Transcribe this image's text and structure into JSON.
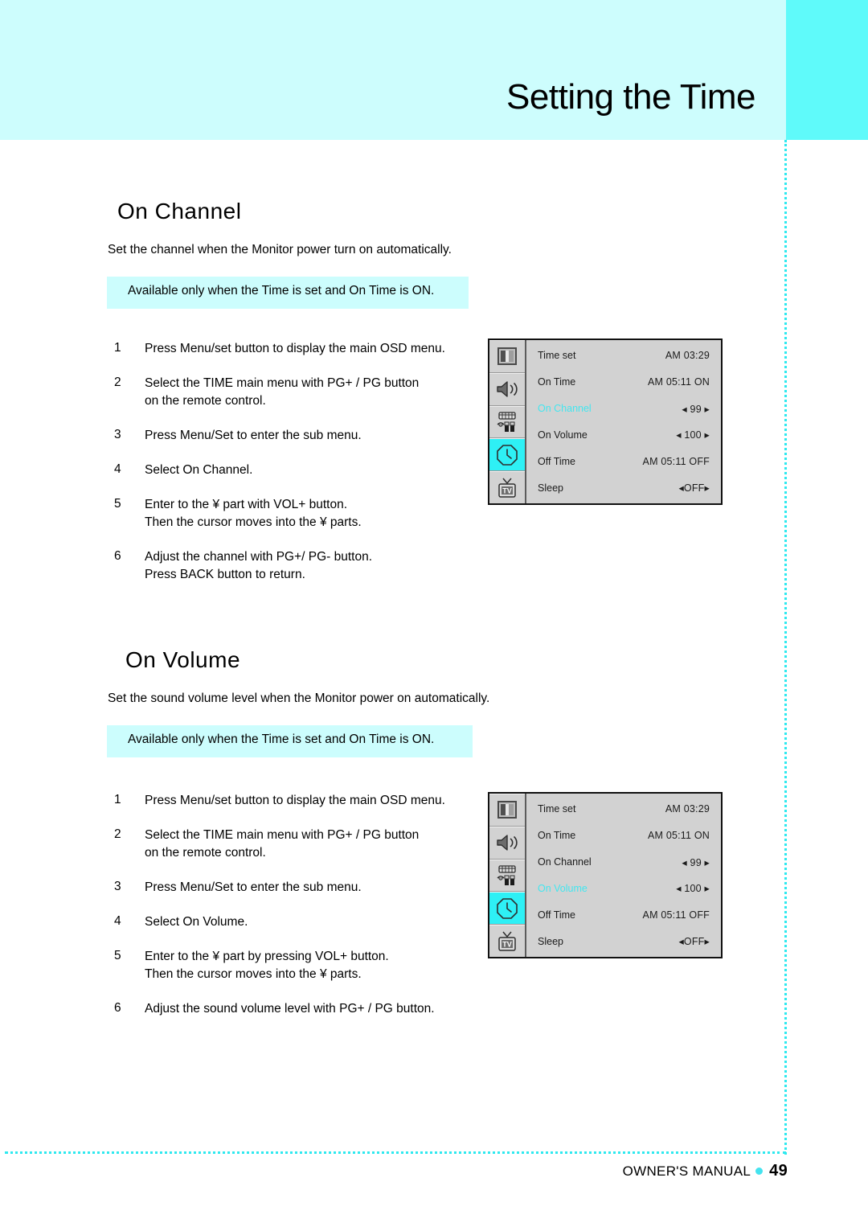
{
  "page": {
    "title": "Setting the Time",
    "footer_label": "OWNER'S MANUAL",
    "page_number": "49",
    "accent_cyan": "#5ffafa",
    "band_cyan": "#cdfdfd",
    "note_cyan": "#ccfdfd",
    "osd_highlight_cyan": "#2ef0f5"
  },
  "sections": [
    {
      "heading": "On Channel",
      "description": "Set the channel when the Monitor power turn on automatically.",
      "note": "Available only when the Time is set and On Time is ON.",
      "steps": [
        {
          "num": "1",
          "text": "Press Menu/set button to display the main OSD menu."
        },
        {
          "num": "2",
          "text": "Select the TIME main menu with PG+ / PG button\non the remote control."
        },
        {
          "num": "3",
          "text": "Press Menu/Set to enter the sub menu."
        },
        {
          "num": "4",
          "text": "Select On Channel."
        },
        {
          "num": "5",
          "text": "Enter to the  ¥     part with VOL+ button.\nThen the cursor moves into the  ¥     parts."
        },
        {
          "num": "6",
          "text": "Adjust the channel with PG+/ PG- button.\nPress BACK button to return."
        }
      ],
      "osd": {
        "icons": [
          {
            "name": "picture-icon",
            "active": false
          },
          {
            "name": "sound-icon",
            "active": false
          },
          {
            "name": "special-icon",
            "active": false
          },
          {
            "name": "clock-icon",
            "active": true
          },
          {
            "name": "tv-icon",
            "active": false
          }
        ],
        "rows": [
          {
            "label": "Time set",
            "value": "AM 03:29",
            "highlight": false
          },
          {
            "label": "On Time",
            "value": "AM 05:11 ON",
            "highlight": false
          },
          {
            "label": "On Channel",
            "value": "◂  99  ▸",
            "highlight": true
          },
          {
            "label": "On Volume",
            "value": "◂ 100 ▸",
            "highlight": false
          },
          {
            "label": "Off Time",
            "value": "AM 05:11 OFF",
            "highlight": false
          },
          {
            "label": "Sleep",
            "value": "◂OFF▸",
            "highlight": false
          }
        ]
      }
    },
    {
      "heading": "On Volume",
      "description": "Set the sound volume level when the Monitor power on automatically.",
      "note": "Available only when the Time is set and On Time is ON.",
      "steps": [
        {
          "num": "1",
          "text": "Press Menu/set button to display the main OSD menu."
        },
        {
          "num": "2",
          "text": "Select the TIME main menu with PG+ / PG button\non the remote control."
        },
        {
          "num": "3",
          "text": "Press Menu/Set to enter the sub menu."
        },
        {
          "num": "4",
          "text": "Select On Volume."
        },
        {
          "num": "5",
          "text": "Enter to the  ¥     part by pressing VOL+ button.\nThen the cursor moves into the  ¥     parts."
        },
        {
          "num": "6",
          "text": "Adjust the sound volume level with PG+ / PG button."
        }
      ],
      "osd": {
        "icons": [
          {
            "name": "picture-icon",
            "active": false
          },
          {
            "name": "sound-icon",
            "active": false
          },
          {
            "name": "special-icon",
            "active": false
          },
          {
            "name": "clock-icon",
            "active": true
          },
          {
            "name": "tv-icon",
            "active": false
          }
        ],
        "rows": [
          {
            "label": "Time set",
            "value": "AM 03:29",
            "highlight": false
          },
          {
            "label": "On Time",
            "value": "AM 05:11 ON",
            "highlight": false
          },
          {
            "label": "On Channel",
            "value": "◂  99  ▸",
            "highlight": false
          },
          {
            "label": "On Volume",
            "value": "◂ 100 ▸",
            "highlight": true
          },
          {
            "label": "Off Time",
            "value": "AM 05:11 OFF",
            "highlight": false
          },
          {
            "label": "Sleep",
            "value": "◂OFF▸",
            "highlight": false
          }
        ]
      }
    }
  ]
}
